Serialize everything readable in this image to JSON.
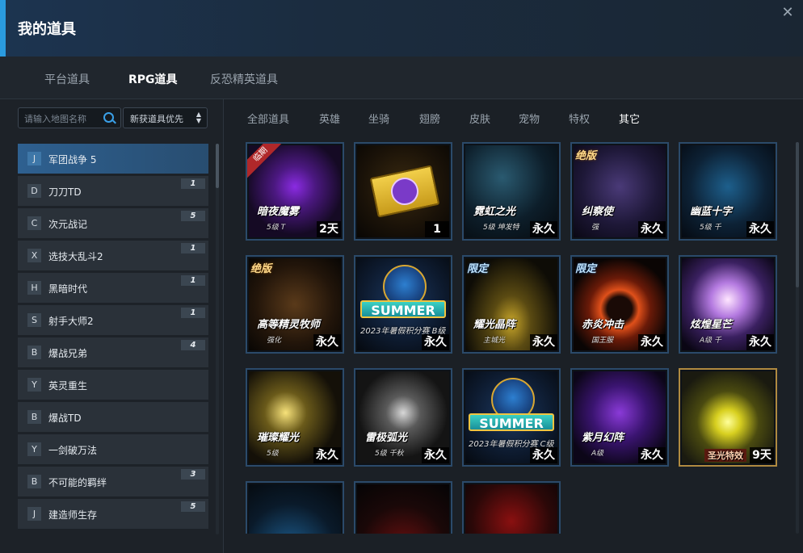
{
  "window": {
    "title": "我的道具",
    "close_icon": "close-icon"
  },
  "main_tabs": [
    {
      "label": "平台道具",
      "active": false
    },
    {
      "label": "RPG道具",
      "active": true
    },
    {
      "label": "反恐精英道具",
      "active": false
    }
  ],
  "search": {
    "placeholder": "请输入地图名称",
    "icon": "search-icon"
  },
  "sort": {
    "selected": "新获道具优先"
  },
  "maps": [
    {
      "letter": "J",
      "name": "军团战争 5",
      "count": "",
      "active": true
    },
    {
      "letter": "D",
      "name": "刀刀TD",
      "count": "1"
    },
    {
      "letter": "C",
      "name": "次元战记",
      "count": "5"
    },
    {
      "letter": "X",
      "name": "选技大乱斗2",
      "count": "1"
    },
    {
      "letter": "H",
      "name": "黑暗时代",
      "count": "1"
    },
    {
      "letter": "S",
      "name": "射手大师2",
      "count": "1"
    },
    {
      "letter": "B",
      "name": "爆战兄弟",
      "count": "4"
    },
    {
      "letter": "Y",
      "name": "英灵重生",
      "count": ""
    },
    {
      "letter": "B",
      "name": "爆战TD",
      "count": ""
    },
    {
      "letter": "Y",
      "name": "一剑破万法",
      "count": ""
    },
    {
      "letter": "B",
      "name": "不可能的羁绊",
      "count": "3"
    },
    {
      "letter": "J",
      "name": "建造师生存",
      "count": "5"
    }
  ],
  "category_tabs": [
    {
      "label": "全部道具",
      "active": false
    },
    {
      "label": "英雄",
      "active": false
    },
    {
      "label": "坐骑",
      "active": false
    },
    {
      "label": "翅膀",
      "active": false
    },
    {
      "label": "皮肤",
      "active": false
    },
    {
      "label": "宠物",
      "active": false
    },
    {
      "label": "特权",
      "active": false
    },
    {
      "label": "其它",
      "active": true
    }
  ],
  "items": [
    {
      "name": "暗夜魔雾",
      "sub": "5级 T",
      "duration": "2天",
      "tag": "",
      "ribbon": "临期",
      "theme": "purple"
    },
    {
      "name": "",
      "sub": "",
      "duration": "1",
      "tag": "",
      "ribbon": "",
      "theme": "ticket"
    },
    {
      "name": "霓虹之光",
      "sub": "5级 坤发特",
      "duration": "永久",
      "tag": "",
      "ribbon": "",
      "theme": "neon"
    },
    {
      "name": "纠察使",
      "sub": "强",
      "duration": "永久",
      "tag": "绝版",
      "ribbon": "",
      "theme": "dark-purple"
    },
    {
      "name": "幽蓝十字",
      "sub": "5级 千",
      "duration": "永久",
      "tag": "",
      "ribbon": "",
      "theme": "blue-cross"
    },
    {
      "name": "高等精灵牧师",
      "sub": "强化",
      "duration": "永久",
      "tag": "绝版",
      "ribbon": "",
      "theme": "priest"
    },
    {
      "name": "",
      "sub": "2023年暑假积分赛 B级",
      "duration": "永久",
      "tag": "",
      "ribbon": "",
      "theme": "summer",
      "badge": "SUMMER"
    },
    {
      "name": "耀光晶阵",
      "sub": "主城光",
      "duration": "永久",
      "tag": "限定",
      "ribbon": "",
      "theme": "gold-beam"
    },
    {
      "name": "赤炎冲击",
      "sub": "国王服",
      "duration": "永久",
      "tag": "限定",
      "ribbon": "",
      "theme": "red-ring"
    },
    {
      "name": "炫煌星芒",
      "sub": "A级 千",
      "duration": "永久",
      "tag": "",
      "ribbon": "",
      "theme": "white-orb"
    },
    {
      "name": "璀璨耀光",
      "sub": "5级",
      "duration": "永久",
      "tag": "",
      "ribbon": "",
      "theme": "gold-swirl"
    },
    {
      "name": "雷极弧光",
      "sub": "5级 千秋",
      "duration": "永久",
      "tag": "",
      "ribbon": "",
      "theme": "spark"
    },
    {
      "name": "",
      "sub": "2023年暑假积分赛 C级",
      "duration": "永久",
      "tag": "",
      "ribbon": "",
      "theme": "summer2",
      "badge": "SUMMER"
    },
    {
      "name": "紫月幻阵",
      "sub": "A级",
      "duration": "永久",
      "tag": "",
      "ribbon": "",
      "theme": "purple-circle"
    },
    {
      "name": "圣光特效",
      "sub": "",
      "duration": "9天",
      "tag": "",
      "ribbon": "",
      "theme": "holy"
    },
    {
      "name": "",
      "sub": "",
      "duration": "",
      "tag": "",
      "ribbon": "",
      "theme": "partial-blue"
    },
    {
      "name": "",
      "sub": "",
      "duration": "",
      "tag": "",
      "ribbon": "",
      "theme": "partial-red"
    },
    {
      "name": "",
      "sub": "",
      "duration": "",
      "tag": "",
      "ribbon": "",
      "theme": "partial-crimson"
    }
  ]
}
